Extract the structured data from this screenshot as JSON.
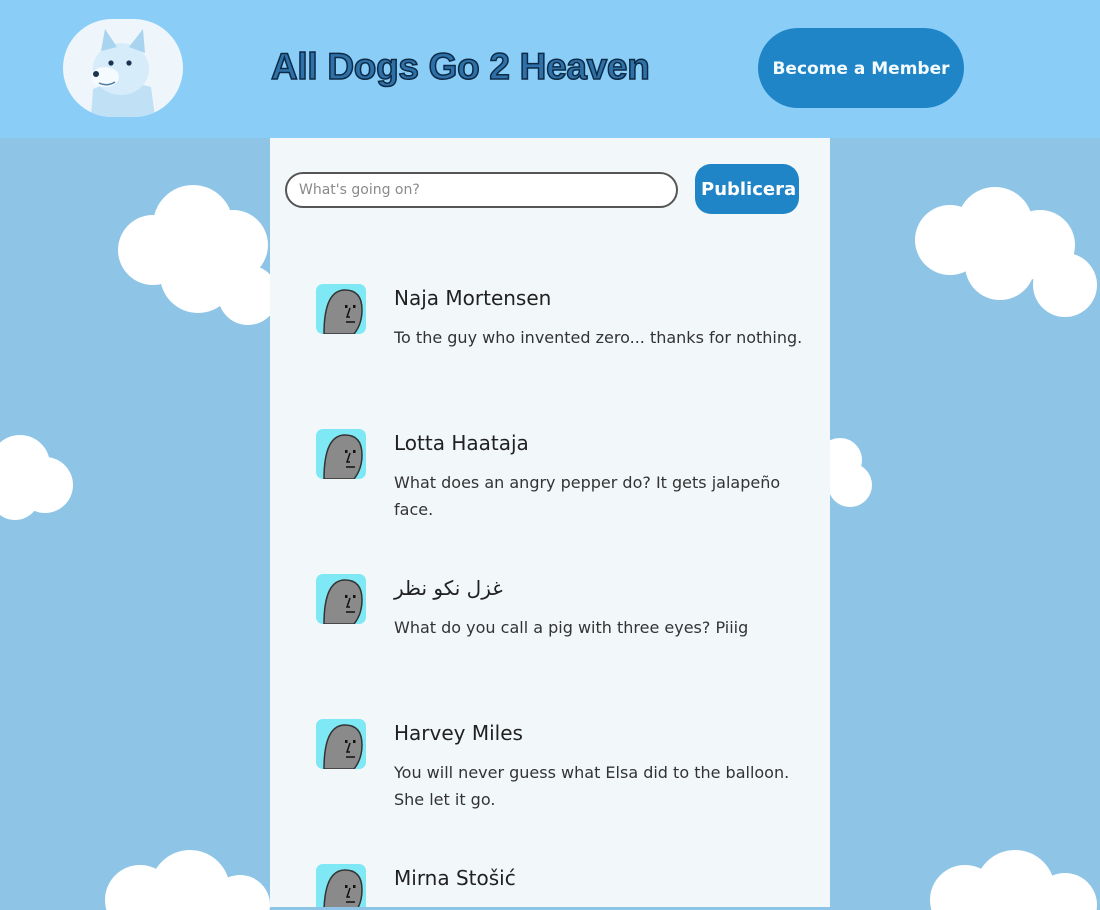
{
  "header": {
    "title": "All Dogs Go 2 Heaven",
    "member_button": "Become a Member",
    "logo_icon": "doge-logo-icon"
  },
  "composer": {
    "placeholder": "What's going on?",
    "publish_button": "Publicera"
  },
  "posts": [
    {
      "name": "Naja Mortensen",
      "text": "To the guy who invented zero... thanks for nothing."
    },
    {
      "name": "Lotta Haataja",
      "text": "What does an angry pepper do? It gets jalapeño face."
    },
    {
      "name": "غزل نکو نظر",
      "text": "What do you call a pig with three eyes? Piiig"
    },
    {
      "name": "Harvey Miles",
      "text": "You will never guess what Elsa did to the balloon. She let it go."
    },
    {
      "name": "Mirna Stošić",
      "text": ""
    }
  ],
  "colors": {
    "header_bg": "#8acef8",
    "page_bg": "#8ec5e6",
    "panel_bg": "#f2f7fa",
    "accent": "#1f85c7",
    "avatar_bg": "#7ee8f5"
  }
}
